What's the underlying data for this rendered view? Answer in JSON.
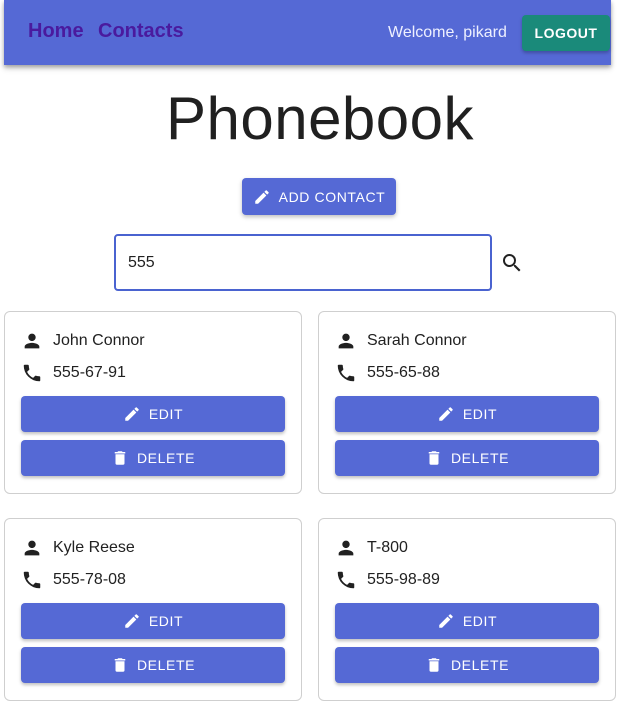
{
  "header": {
    "nav": [
      {
        "label": "Home"
      },
      {
        "label": "Contacts"
      }
    ],
    "welcome_text": "Welcome, pikard",
    "logout_label": "LOGOUT"
  },
  "page": {
    "title": "Phonebook",
    "add_button_label": "ADD CONTACT"
  },
  "search": {
    "value": "555"
  },
  "contacts": [
    {
      "name": "John Connor",
      "phone": "555-67-91",
      "edit_label": "EDIT",
      "delete_label": "DELETE"
    },
    {
      "name": "Sarah Connor",
      "phone": "555-65-88",
      "edit_label": "EDIT",
      "delete_label": "DELETE"
    },
    {
      "name": "Kyle Reese",
      "phone": "555-78-08",
      "edit_label": "EDIT",
      "delete_label": "DELETE"
    },
    {
      "name": "T-800",
      "phone": "555-98-89",
      "edit_label": "EDIT",
      "delete_label": "DELETE"
    }
  ],
  "colors": {
    "primary": "#5569d5",
    "logout": "#1a8a7a",
    "nav_link": "#4a1a9e"
  },
  "icons": {
    "add": "pencil-icon",
    "search": "search-icon",
    "name": "person-icon",
    "phone": "phone-icon",
    "edit": "pencil-icon",
    "delete": "trash-icon"
  }
}
